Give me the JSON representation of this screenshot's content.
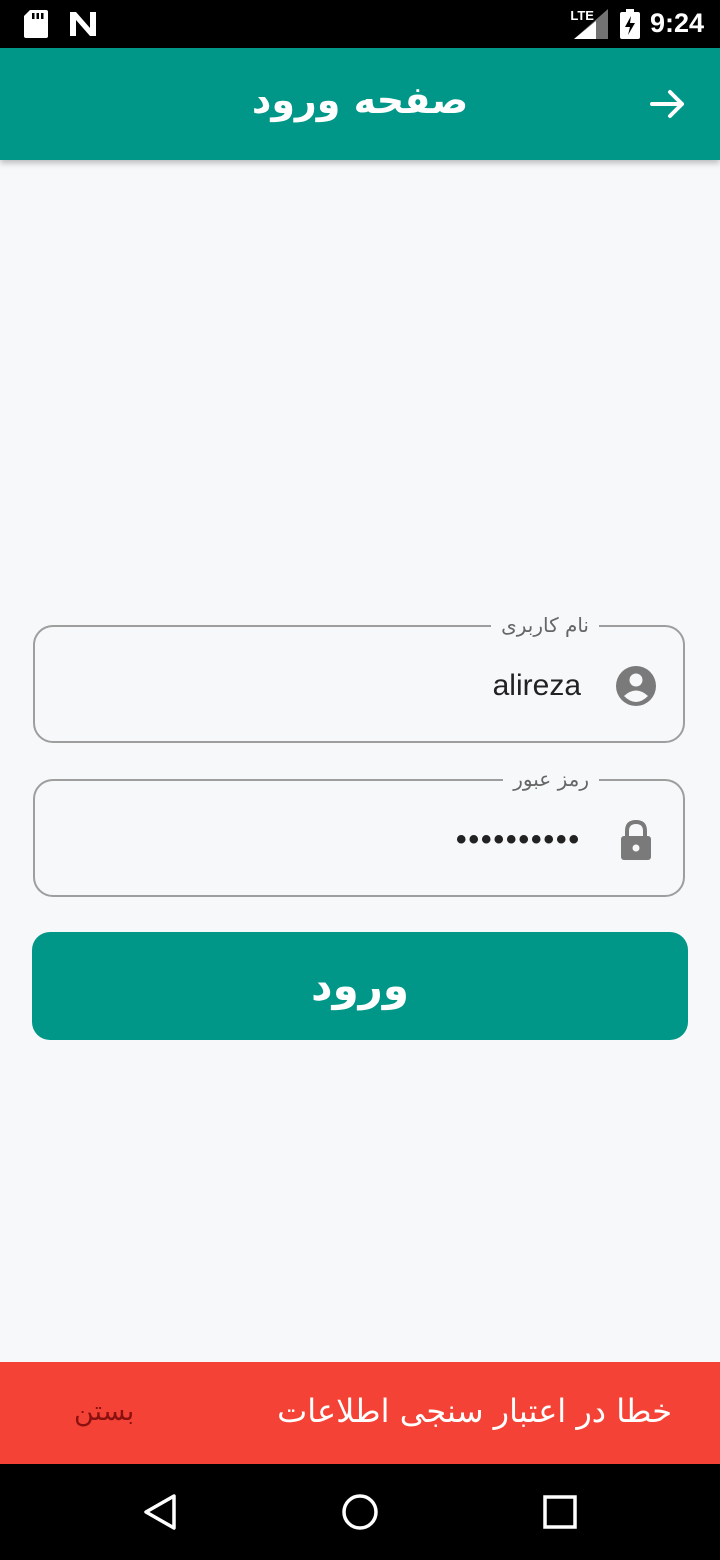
{
  "status_bar": {
    "network": "LTE",
    "time": "9:24",
    "icons": [
      "sd-card-icon",
      "n-icon",
      "lte-signal-icon",
      "battery-charging-icon"
    ]
  },
  "app_bar": {
    "title": "صفحه ورود",
    "back_icon": "arrow-right-icon"
  },
  "form": {
    "username": {
      "label": "نام کاربری",
      "value": "alireza",
      "icon": "account-circle-icon"
    },
    "password": {
      "label": "رمز عبور",
      "value": "••••••••••",
      "icon": "lock-icon"
    },
    "submit_label": "ورود"
  },
  "snackbar": {
    "message": "خطا در اعتبار سنجی اطلاعات",
    "action_label": "بستن"
  },
  "colors": {
    "primary": "#009688",
    "error": "#f44336",
    "background": "#f6f8fa"
  },
  "nav_bar": {
    "buttons": [
      "back-triangle-icon",
      "home-circle-icon",
      "recents-square-icon"
    ]
  }
}
